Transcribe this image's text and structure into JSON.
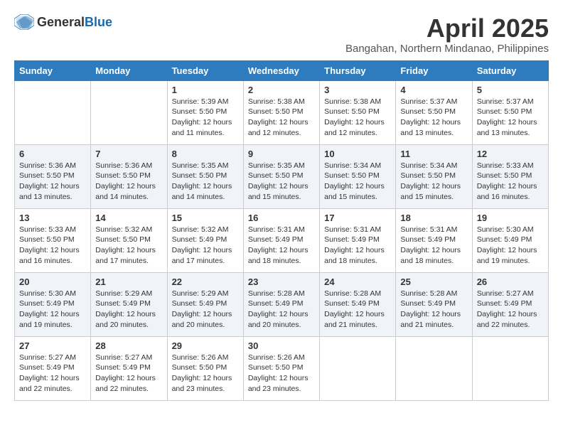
{
  "logo": {
    "general": "General",
    "blue": "Blue"
  },
  "title": "April 2025",
  "location": "Bangahan, Northern Mindanao, Philippines",
  "days": [
    "Sunday",
    "Monday",
    "Tuesday",
    "Wednesday",
    "Thursday",
    "Friday",
    "Saturday"
  ],
  "weeks": [
    [
      {
        "day": "",
        "sunrise": "",
        "sunset": "",
        "daylight": ""
      },
      {
        "day": "",
        "sunrise": "",
        "sunset": "",
        "daylight": ""
      },
      {
        "day": "1",
        "sunrise": "Sunrise: 5:39 AM",
        "sunset": "Sunset: 5:50 PM",
        "daylight": "Daylight: 12 hours and 11 minutes."
      },
      {
        "day": "2",
        "sunrise": "Sunrise: 5:38 AM",
        "sunset": "Sunset: 5:50 PM",
        "daylight": "Daylight: 12 hours and 12 minutes."
      },
      {
        "day": "3",
        "sunrise": "Sunrise: 5:38 AM",
        "sunset": "Sunset: 5:50 PM",
        "daylight": "Daylight: 12 hours and 12 minutes."
      },
      {
        "day": "4",
        "sunrise": "Sunrise: 5:37 AM",
        "sunset": "Sunset: 5:50 PM",
        "daylight": "Daylight: 12 hours and 13 minutes."
      },
      {
        "day": "5",
        "sunrise": "Sunrise: 5:37 AM",
        "sunset": "Sunset: 5:50 PM",
        "daylight": "Daylight: 12 hours and 13 minutes."
      }
    ],
    [
      {
        "day": "6",
        "sunrise": "Sunrise: 5:36 AM",
        "sunset": "Sunset: 5:50 PM",
        "daylight": "Daylight: 12 hours and 13 minutes."
      },
      {
        "day": "7",
        "sunrise": "Sunrise: 5:36 AM",
        "sunset": "Sunset: 5:50 PM",
        "daylight": "Daylight: 12 hours and 14 minutes."
      },
      {
        "day": "8",
        "sunrise": "Sunrise: 5:35 AM",
        "sunset": "Sunset: 5:50 PM",
        "daylight": "Daylight: 12 hours and 14 minutes."
      },
      {
        "day": "9",
        "sunrise": "Sunrise: 5:35 AM",
        "sunset": "Sunset: 5:50 PM",
        "daylight": "Daylight: 12 hours and 15 minutes."
      },
      {
        "day": "10",
        "sunrise": "Sunrise: 5:34 AM",
        "sunset": "Sunset: 5:50 PM",
        "daylight": "Daylight: 12 hours and 15 minutes."
      },
      {
        "day": "11",
        "sunrise": "Sunrise: 5:34 AM",
        "sunset": "Sunset: 5:50 PM",
        "daylight": "Daylight: 12 hours and 15 minutes."
      },
      {
        "day": "12",
        "sunrise": "Sunrise: 5:33 AM",
        "sunset": "Sunset: 5:50 PM",
        "daylight": "Daylight: 12 hours and 16 minutes."
      }
    ],
    [
      {
        "day": "13",
        "sunrise": "Sunrise: 5:33 AM",
        "sunset": "Sunset: 5:50 PM",
        "daylight": "Daylight: 12 hours and 16 minutes."
      },
      {
        "day": "14",
        "sunrise": "Sunrise: 5:32 AM",
        "sunset": "Sunset: 5:50 PM",
        "daylight": "Daylight: 12 hours and 17 minutes."
      },
      {
        "day": "15",
        "sunrise": "Sunrise: 5:32 AM",
        "sunset": "Sunset: 5:49 PM",
        "daylight": "Daylight: 12 hours and 17 minutes."
      },
      {
        "day": "16",
        "sunrise": "Sunrise: 5:31 AM",
        "sunset": "Sunset: 5:49 PM",
        "daylight": "Daylight: 12 hours and 18 minutes."
      },
      {
        "day": "17",
        "sunrise": "Sunrise: 5:31 AM",
        "sunset": "Sunset: 5:49 PM",
        "daylight": "Daylight: 12 hours and 18 minutes."
      },
      {
        "day": "18",
        "sunrise": "Sunrise: 5:31 AM",
        "sunset": "Sunset: 5:49 PM",
        "daylight": "Daylight: 12 hours and 18 minutes."
      },
      {
        "day": "19",
        "sunrise": "Sunrise: 5:30 AM",
        "sunset": "Sunset: 5:49 PM",
        "daylight": "Daylight: 12 hours and 19 minutes."
      }
    ],
    [
      {
        "day": "20",
        "sunrise": "Sunrise: 5:30 AM",
        "sunset": "Sunset: 5:49 PM",
        "daylight": "Daylight: 12 hours and 19 minutes."
      },
      {
        "day": "21",
        "sunrise": "Sunrise: 5:29 AM",
        "sunset": "Sunset: 5:49 PM",
        "daylight": "Daylight: 12 hours and 20 minutes."
      },
      {
        "day": "22",
        "sunrise": "Sunrise: 5:29 AM",
        "sunset": "Sunset: 5:49 PM",
        "daylight": "Daylight: 12 hours and 20 minutes."
      },
      {
        "day": "23",
        "sunrise": "Sunrise: 5:28 AM",
        "sunset": "Sunset: 5:49 PM",
        "daylight": "Daylight: 12 hours and 20 minutes."
      },
      {
        "day": "24",
        "sunrise": "Sunrise: 5:28 AM",
        "sunset": "Sunset: 5:49 PM",
        "daylight": "Daylight: 12 hours and 21 minutes."
      },
      {
        "day": "25",
        "sunrise": "Sunrise: 5:28 AM",
        "sunset": "Sunset: 5:49 PM",
        "daylight": "Daylight: 12 hours and 21 minutes."
      },
      {
        "day": "26",
        "sunrise": "Sunrise: 5:27 AM",
        "sunset": "Sunset: 5:49 PM",
        "daylight": "Daylight: 12 hours and 22 minutes."
      }
    ],
    [
      {
        "day": "27",
        "sunrise": "Sunrise: 5:27 AM",
        "sunset": "Sunset: 5:49 PM",
        "daylight": "Daylight: 12 hours and 22 minutes."
      },
      {
        "day": "28",
        "sunrise": "Sunrise: 5:27 AM",
        "sunset": "Sunset: 5:49 PM",
        "daylight": "Daylight: 12 hours and 22 minutes."
      },
      {
        "day": "29",
        "sunrise": "Sunrise: 5:26 AM",
        "sunset": "Sunset: 5:50 PM",
        "daylight": "Daylight: 12 hours and 23 minutes."
      },
      {
        "day": "30",
        "sunrise": "Sunrise: 5:26 AM",
        "sunset": "Sunset: 5:50 PM",
        "daylight": "Daylight: 12 hours and 23 minutes."
      },
      {
        "day": "",
        "sunrise": "",
        "sunset": "",
        "daylight": ""
      },
      {
        "day": "",
        "sunrise": "",
        "sunset": "",
        "daylight": ""
      },
      {
        "day": "",
        "sunrise": "",
        "sunset": "",
        "daylight": ""
      }
    ]
  ]
}
